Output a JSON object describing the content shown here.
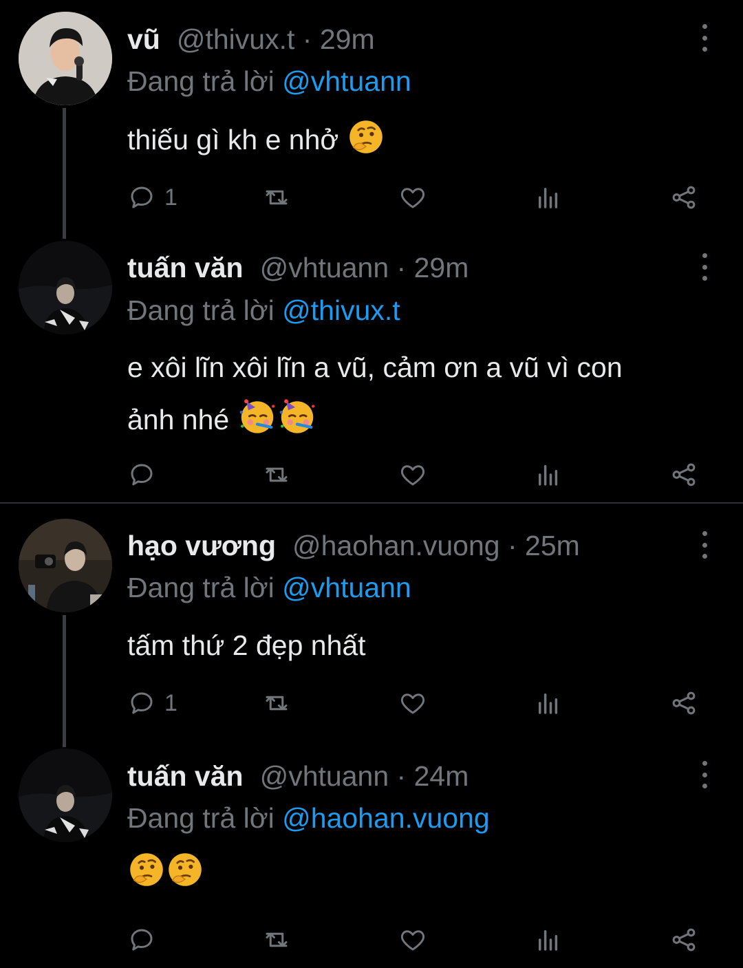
{
  "tweets": [
    {
      "name": "vũ",
      "handle": "@thivux.t",
      "separator": "·",
      "time": "29m",
      "reply_prefix": "Đang trả lời",
      "reply_to": "@vhtuann",
      "text": "thiếu gì kh e nhở",
      "emojis": [
        "thinking-face"
      ],
      "reply_count": "1"
    },
    {
      "name": "tuấn văn",
      "handle": "@vhtuann",
      "separator": "·",
      "time": "29m",
      "reply_prefix": "Đang trả lời",
      "reply_to": "@thivux.t",
      "text_line1": "e xôi lĩn xôi lĩn a vũ, cảm ơn a vũ vì con",
      "text_line2": "ảnh nhé",
      "emojis": [
        "partying-face",
        "partying-face"
      ],
      "reply_count": ""
    },
    {
      "name": "hạo vương",
      "handle": "@haohan.vuong",
      "separator": "·",
      "time": "25m",
      "reply_prefix": "Đang trả lời",
      "reply_to": "@vhtuann",
      "text": "tấm thứ 2 đẹp nhất",
      "reply_count": "1"
    },
    {
      "name": "tuấn văn",
      "handle": "@vhtuann",
      "separator": "·",
      "time": "24m",
      "reply_prefix": "Đang trả lời",
      "reply_to": "@haohan.vuong",
      "text": "",
      "emojis": [
        "thinking-face",
        "thinking-face"
      ],
      "reply_count": ""
    }
  ],
  "icons": [
    "reply-icon",
    "retweet-icon",
    "like-icon",
    "analytics-icon",
    "share-icon",
    "more-options-icon"
  ],
  "colors": {
    "background": "#000000",
    "text": "#e7e9ea",
    "muted": "#71767b",
    "link": "#1d9bf0"
  }
}
